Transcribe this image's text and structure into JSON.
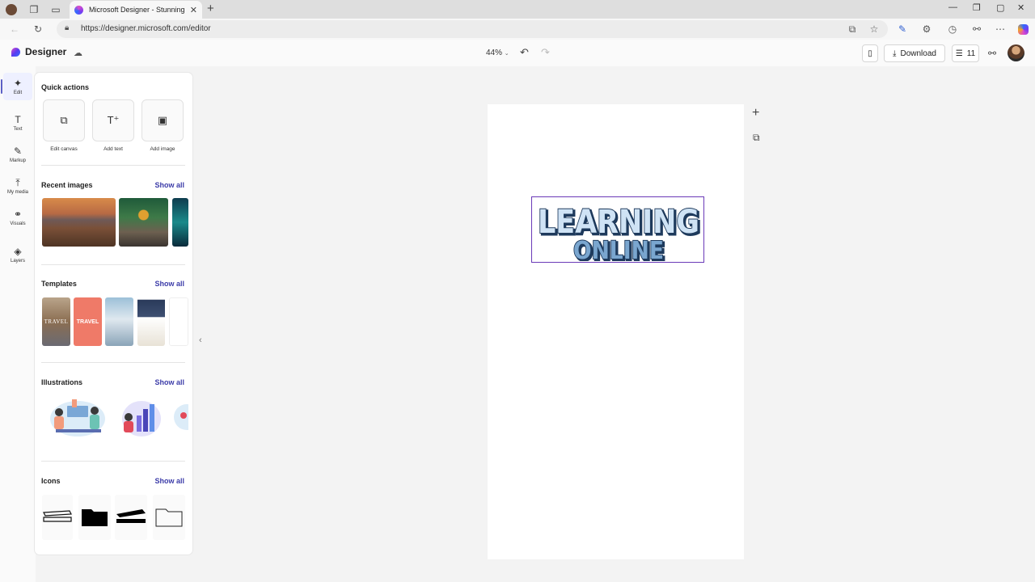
{
  "browser": {
    "tab_title": "Microsoft Designer - Stunning de",
    "tab_close": "✕",
    "new_tab": "+",
    "url": "https://designer.microsoft.com/editor"
  },
  "header": {
    "brand": "Designer",
    "zoom": "44%",
    "download_label": "Download",
    "credits": "11"
  },
  "rail": [
    {
      "label": "Edit",
      "icon": "magic-edit-icon"
    },
    {
      "label": "Text",
      "icon": "text-icon"
    },
    {
      "label": "Markup",
      "icon": "pen-icon"
    },
    {
      "label": "My media",
      "icon": "upload-icon"
    },
    {
      "label": "Visuals",
      "icon": "shapes-icon"
    },
    {
      "label": "Layers",
      "icon": "layers-icon"
    }
  ],
  "panel": {
    "quick_actions": {
      "title": "Quick actions",
      "items": [
        {
          "label": "Edit canvas",
          "icon": "resize-icon"
        },
        {
          "label": "Add text",
          "icon": "add-text-icon"
        },
        {
          "label": "Add image",
          "icon": "add-image-icon"
        }
      ]
    },
    "recent_images": {
      "title": "Recent images",
      "show_all": "Show all"
    },
    "templates": {
      "title": "Templates",
      "show_all": "Show all",
      "items": [
        "TRAVEL",
        "TRAVEL"
      ]
    },
    "illustrations": {
      "title": "Illustrations",
      "show_all": "Show all"
    },
    "icons": {
      "title": "Icons",
      "show_all": "Show all"
    }
  },
  "canvas": {
    "headline_line1": "LEARNING",
    "headline_line2": "ONLINE"
  },
  "colors": {
    "accent": "#5b5fc7",
    "selection": "#6a3ab8",
    "text_fill": "#cfe3f5",
    "text_outline": "#1e3a5c"
  }
}
